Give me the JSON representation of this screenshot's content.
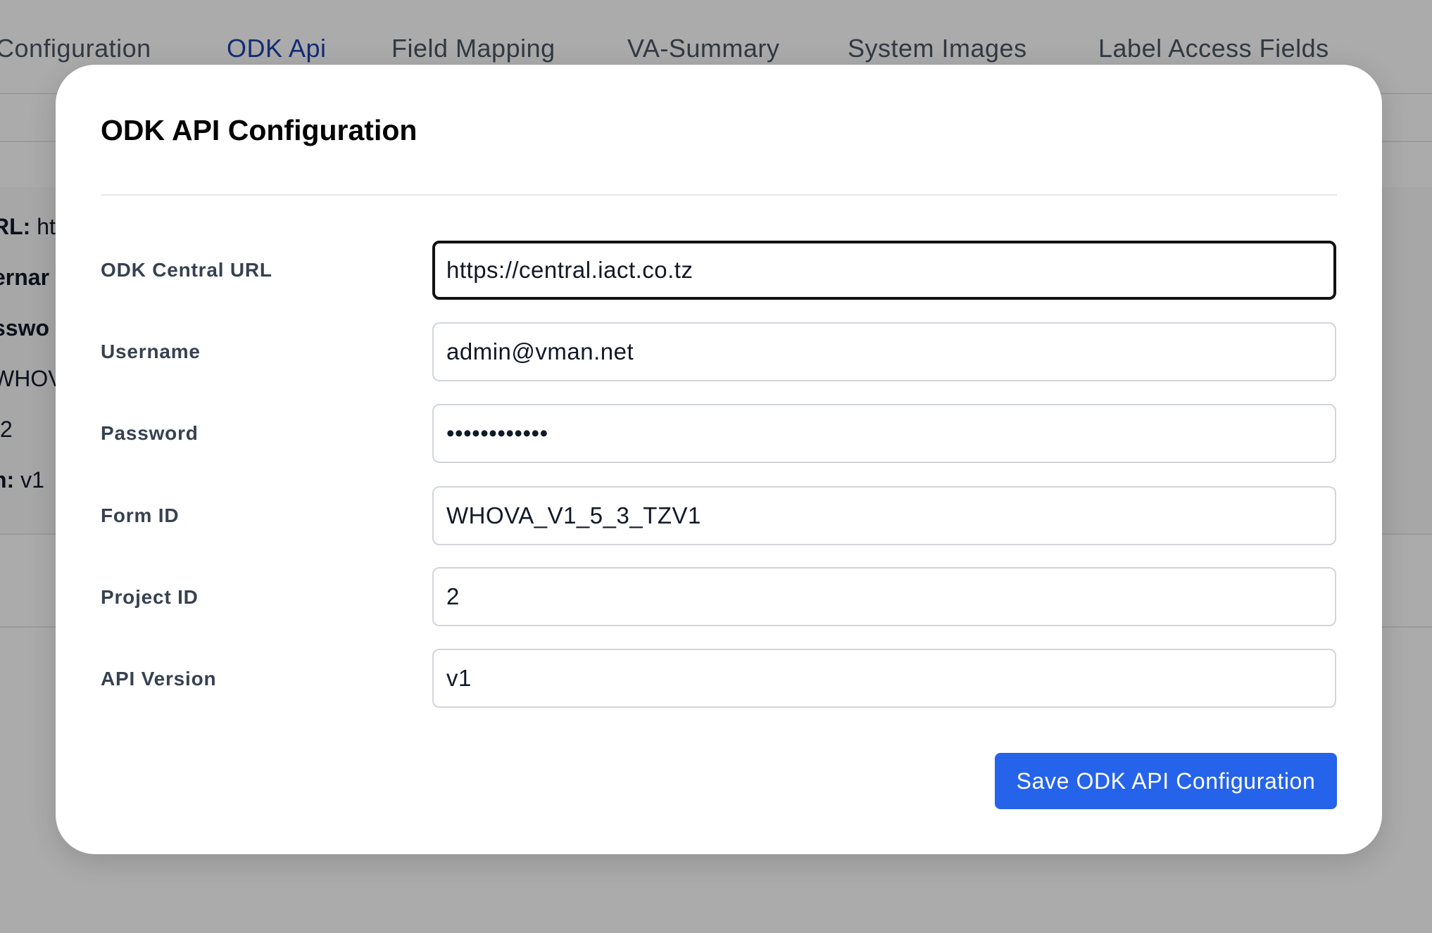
{
  "tabs": [
    {
      "label": "Configuration",
      "active": false
    },
    {
      "label": "ODK Api",
      "active": true
    },
    {
      "label": "Field Mapping",
      "active": false
    },
    {
      "label": "VA-Summary",
      "active": false
    },
    {
      "label": "System Images",
      "active": false
    },
    {
      "label": "Label Access Fields",
      "active": false
    }
  ],
  "background_summary": [
    {
      "label": "RL:",
      "value": " htt"
    },
    {
      "label": "ernar",
      "value": ""
    },
    {
      "label": "sswo",
      "value": ""
    },
    {
      "label": "",
      "value": "WHOV"
    },
    {
      "label": "",
      "value": "2"
    },
    {
      "label": "n:",
      "value": " v1"
    }
  ],
  "modal": {
    "title": "ODK API Configuration",
    "fields": [
      {
        "label": "ODK Central URL",
        "value": "https://central.iact.co.tz",
        "type": "text"
      },
      {
        "label": "Username",
        "value": "admin@vman.net",
        "type": "text"
      },
      {
        "label": "Password",
        "value": "••••••••••••",
        "type": "password"
      },
      {
        "label": "Form ID",
        "value": "WHOVA_V1_5_3_TZV1",
        "type": "text"
      },
      {
        "label": "Project ID",
        "value": "2",
        "type": "text"
      },
      {
        "label": "API Version",
        "value": "v1",
        "type": "text"
      }
    ],
    "save_label": "Save ODK API Configuration"
  },
  "colors": {
    "accent": "#2563eb",
    "active_tab": "#1e40af",
    "overlay": "rgba(0,0,0,0.33)"
  }
}
